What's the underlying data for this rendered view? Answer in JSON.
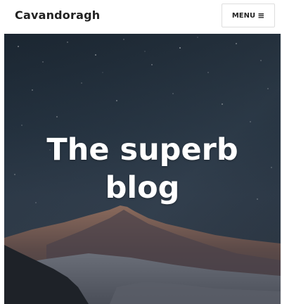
{
  "header": {
    "site_title": "Cavandoragh",
    "menu_label": "MENU",
    "menu_icon": "hamburger-icon"
  },
  "hero": {
    "title_line1": "The superb",
    "title_line2": "blog",
    "background": "night-sky-mountain-image"
  },
  "colors": {
    "header_bg": "#ffffff",
    "text": "#222222",
    "hero_title": "#ffffff",
    "sky": "#1f2b37"
  }
}
